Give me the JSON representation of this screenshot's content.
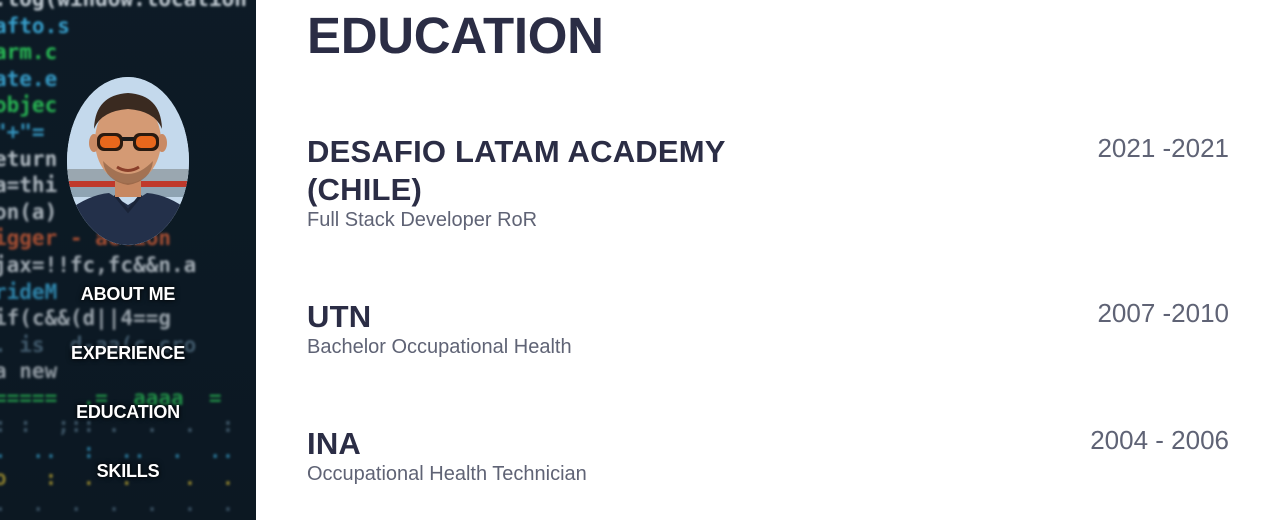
{
  "sidebar": {
    "nav": [
      {
        "label": "ABOUT ME"
      },
      {
        "label": "EXPERIENCE"
      },
      {
        "label": "EDUCATION"
      },
      {
        "label": "SKILLS"
      }
    ]
  },
  "main": {
    "title": "EDUCATION",
    "entries": [
      {
        "name": "DESAFIO LATAM ACADEMY (CHILE)",
        "degree": "Full Stack Developer RoR",
        "years": "2021 -2021"
      },
      {
        "name": "UTN",
        "degree": "Bachelor Occupational Health",
        "years": "2007 -2010"
      },
      {
        "name": "INA",
        "degree": "Occupational Health Technician",
        "years": "2004 - 2006"
      }
    ]
  }
}
